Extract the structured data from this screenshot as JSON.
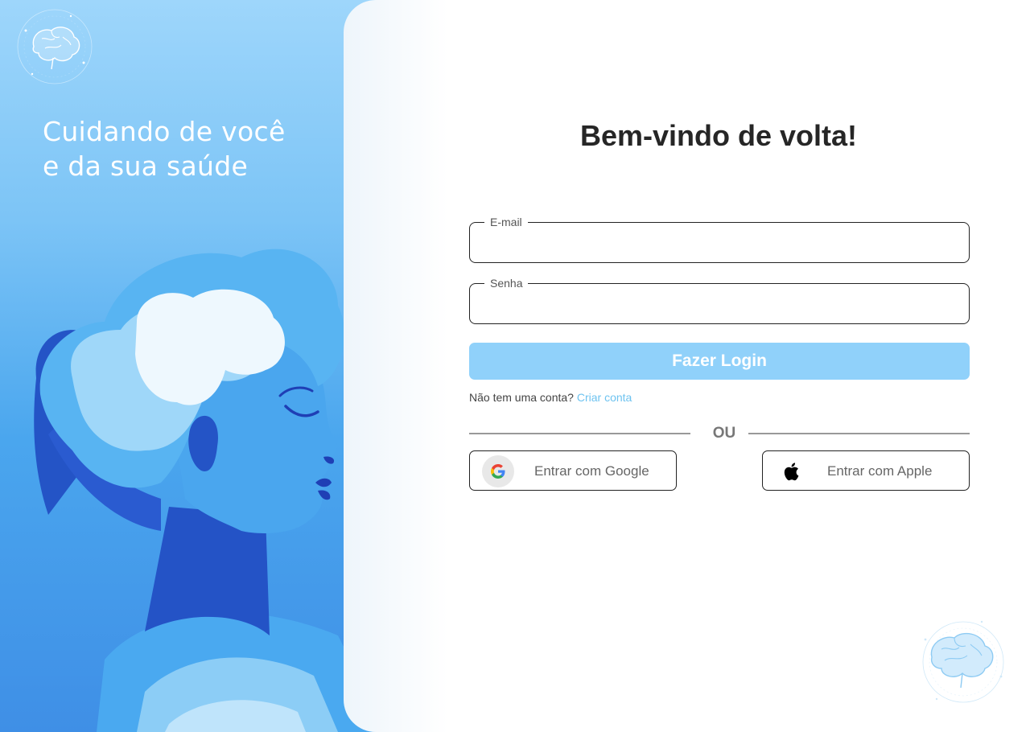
{
  "hero": {
    "title_line1": "Cuidando de você",
    "title_line2": "e da sua saúde"
  },
  "login": {
    "title": "Bem-vindo de volta!",
    "email": {
      "label": "E-mail",
      "value": ""
    },
    "password": {
      "label": "Senha",
      "value": ""
    },
    "submit_label": "Fazer Login",
    "signup_prompt": "Não tem uma conta?",
    "signup_link": "Criar conta",
    "divider_text": "OU",
    "google_label": "Entrar com Google",
    "apple_label": "Entrar com Apple"
  },
  "icons": {
    "brand": "brain-icon",
    "google": "google-icon",
    "apple": "apple-icon"
  },
  "colors": {
    "primary_button": "#90d1fa",
    "link": "#6ec3f0",
    "hero_gradient_top": "#9ed6fb",
    "hero_gradient_bottom": "#3f8fe6",
    "title_text": "#262626"
  }
}
